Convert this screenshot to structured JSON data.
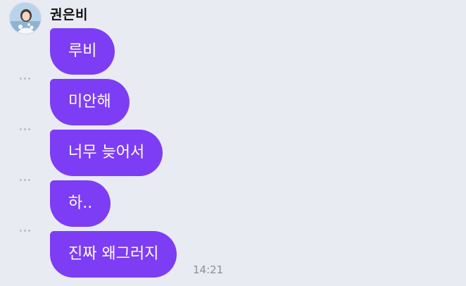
{
  "chat": {
    "sender": {
      "name": "권은비",
      "avatar_icon": "profile-photo"
    },
    "messages": [
      {
        "text": "루비"
      },
      {
        "text": "미안해"
      },
      {
        "text": "너무 늦어서"
      },
      {
        "text": "하.."
      },
      {
        "text": "진짜 왜그러지"
      }
    ],
    "last_timestamp": "14:21"
  },
  "colors": {
    "bubble": "#7d3df4",
    "background": "#e8ebf2",
    "text_on_bubble": "#ffffff"
  }
}
